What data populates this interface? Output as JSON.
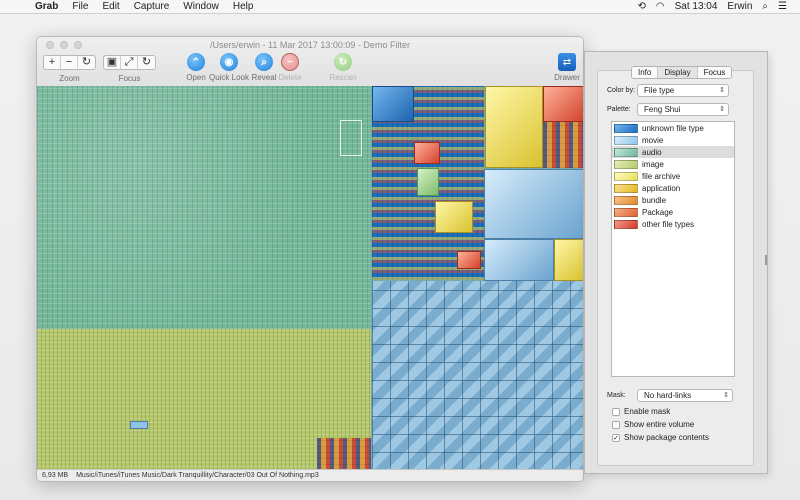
{
  "menubar": {
    "app_name": "Grab",
    "items": [
      "File",
      "Edit",
      "Capture",
      "Window",
      "Help"
    ],
    "clock": "Sat 13:04",
    "user": "Erwin"
  },
  "window": {
    "title": "/Users/erwin - 11 Mar 2017 13:00:09 - Demo Filter",
    "toolbar": {
      "zoom_label": "Zoom",
      "focus_label": "Focus",
      "open_label": "Open",
      "quicklook_label": "Quick Look",
      "reveal_label": "Reveal",
      "delete_label": "Delete",
      "rescan_label": "Rescan",
      "drawer_label": "Drawer"
    },
    "status": {
      "size": "6,93 MB",
      "path": "Music/iTunes/iTunes Music/Dark Tranquillity/Character/03 Out Of Nothing.mp3"
    }
  },
  "drawer": {
    "tabs": [
      "Info",
      "Display",
      "Focus"
    ],
    "active_tab": "Display",
    "color_by_label": "Color by:",
    "color_by_value": "File type",
    "palette_label": "Palette:",
    "palette_value": "Feng Shui",
    "legend": [
      {
        "label": "unknown file type",
        "color": "#1e6fc0"
      },
      {
        "label": "movie",
        "color": "#8fc4e8"
      },
      {
        "label": "audio",
        "color": "#6fb69b"
      },
      {
        "label": "image",
        "color": "#b4c96c"
      },
      {
        "label": "file archive",
        "color": "#e9df5a"
      },
      {
        "label": "application",
        "color": "#e2b623"
      },
      {
        "label": "bundle",
        "color": "#e08a28"
      },
      {
        "label": "Package",
        "color": "#e06330"
      },
      {
        "label": "other file types",
        "color": "#d23a2a"
      }
    ],
    "selected_legend": "audio",
    "mask_label": "Mask:",
    "mask_value": "No hard-links",
    "checkboxes": {
      "enable_mask": {
        "label": "Enable mask",
        "checked": false
      },
      "show_entire_volume": {
        "label": "Show entire volume",
        "checked": false
      },
      "show_package_contents": {
        "label": "Show package contents",
        "checked": true
      }
    }
  }
}
